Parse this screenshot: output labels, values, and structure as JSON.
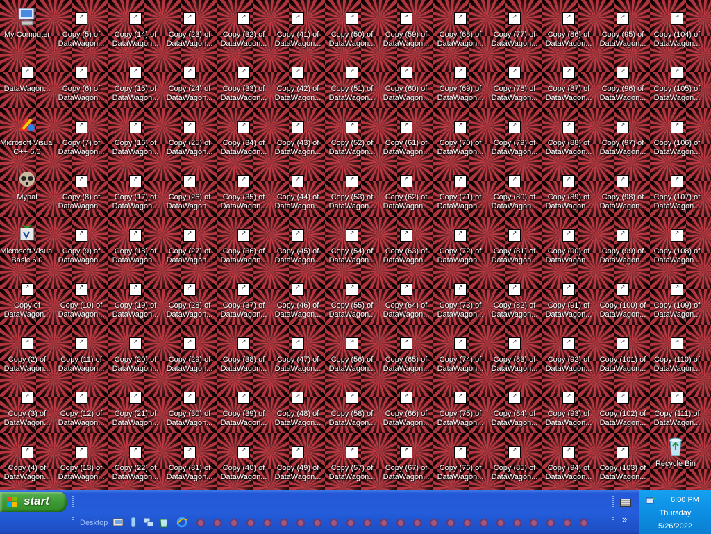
{
  "desktop": {
    "special_icons": [
      {
        "label": "My Computer",
        "icon": "computer-icon"
      },
      {
        "label": "DataWagon...",
        "icon": "shortcut-icon"
      },
      {
        "label": "Microsoft Visual C++ 6.0",
        "icon": "visual-cpp-icon"
      },
      {
        "label": "Mypal",
        "icon": "mypal-raccoon-icon"
      },
      {
        "label": "Microsoft Visual Basic 6.0",
        "icon": "visual-basic-icon"
      },
      {
        "label": "Copy of\nDataWagon...",
        "icon": "shortcut-icon"
      },
      {
        "label": "Copy (2) of\nDataWagon...",
        "icon": "shortcut-icon"
      },
      {
        "label": "Copy (3) of\nDataWagon...",
        "icon": "shortcut-icon"
      },
      {
        "label": "Copy (4) of\nDataWagon...",
        "icon": "shortcut-icon"
      }
    ],
    "copy_columns": [
      [
        "5",
        "6",
        "7",
        "8",
        "9",
        "10",
        "11",
        "12",
        "13"
      ],
      [
        "14",
        "15",
        "16",
        "17",
        "18",
        "19",
        "20",
        "21",
        "22"
      ],
      [
        "23",
        "24",
        "25",
        "26",
        "27",
        "28",
        "29",
        "30",
        "31"
      ],
      [
        "32",
        "33",
        "34",
        "35",
        "36",
        "37",
        "38",
        "39",
        "40"
      ],
      [
        "41",
        "42",
        "43",
        "44",
        "45",
        "46",
        "47",
        "48",
        "49"
      ],
      [
        "50",
        "51",
        "52",
        "53",
        "54",
        "55",
        "56",
        "58",
        "57"
      ],
      [
        "59",
        "60",
        "61",
        "62",
        "63",
        "64",
        "65",
        "66",
        "67"
      ],
      [
        "68",
        "69",
        "70",
        "71",
        "72",
        "73",
        "74",
        "75",
        "76"
      ],
      [
        "77",
        "78",
        "79",
        "80",
        "81",
        "82",
        "83",
        "84",
        "85"
      ],
      [
        "86",
        "87",
        "88",
        "89",
        "90",
        "91",
        "92",
        "93",
        "94"
      ],
      [
        "95",
        "96",
        "97",
        "98",
        "99",
        "100",
        "101",
        "102",
        "103"
      ],
      [
        "104",
        "105",
        "106",
        "107",
        "108",
        "109",
        "110",
        "111",
        ""
      ]
    ],
    "copy_label_prefix": "Copy (",
    "copy_label_suffix": ") of\nDataWagon...",
    "recycle_bin": {
      "label": "Recycle Bin",
      "icon": "recycle-bin-icon"
    },
    "wallpaper_colors": {
      "background": "#0a0000",
      "star": "#c83c46"
    }
  },
  "taskbar": {
    "start_label": "start",
    "desktop_toolbar_label": "Desktop",
    "quick_launch": [
      "show-desktop-icon",
      "windows-media-icon",
      "network-icon",
      "recycle-icon",
      "internet-explorer-icon"
    ],
    "chevron": "»",
    "clock": {
      "time": "6:00 PM",
      "day": "Thursday",
      "date": "5/26/2022"
    },
    "colors": {
      "taskbar": "#245ddb",
      "start": "#3d9a35",
      "tray": "#0d8fe3"
    }
  }
}
